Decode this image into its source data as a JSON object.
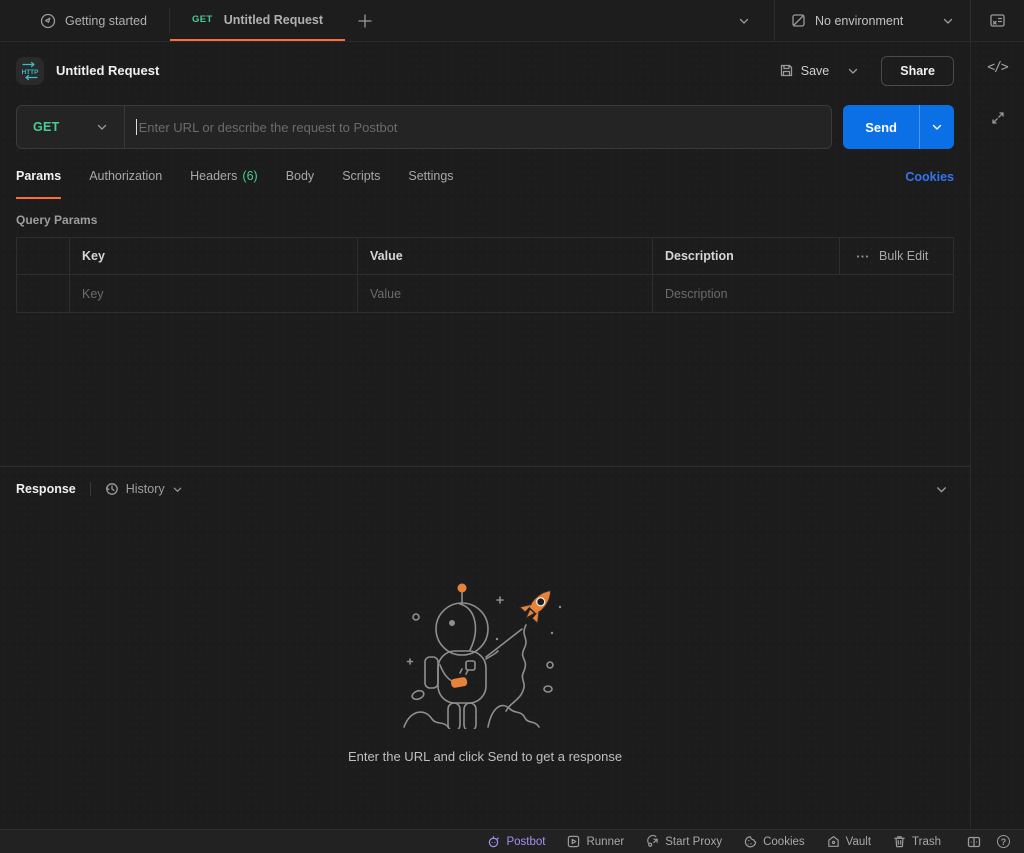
{
  "topbar": {
    "getting_started": "Getting started",
    "active_tab": {
      "method": "GET",
      "label": "Untitled Request"
    },
    "environment": "No environment"
  },
  "request": {
    "title": "Untitled Request",
    "save": "Save",
    "share": "Share",
    "method": "GET",
    "url_placeholder": "Enter URL or describe the request to Postbot",
    "send": "Send",
    "tabs": [
      {
        "label": "Params"
      },
      {
        "label": "Authorization"
      },
      {
        "label": "Headers"
      },
      {
        "label": "Body"
      },
      {
        "label": "Scripts"
      },
      {
        "label": "Settings"
      }
    ],
    "headers_count": "(6)",
    "cookies": "Cookies"
  },
  "params": {
    "title": "Query Params",
    "col_key": "Key",
    "col_value": "Value",
    "col_desc": "Description",
    "bulk_edit": "Bulk Edit",
    "ph_key": "Key",
    "ph_value": "Value",
    "ph_desc": "Description"
  },
  "response": {
    "title": "Response",
    "history": "History",
    "empty": "Enter the URL and click Send to get a response"
  },
  "footer": {
    "postbot": "Postbot",
    "runner": "Runner",
    "proxy": "Start Proxy",
    "cookies": "Cookies",
    "vault": "Vault",
    "trash": "Trash"
  },
  "colors": {
    "accent_orange": "#ff6c37",
    "method_green": "#49cc90",
    "send_blue": "#0b6fe5",
    "link_blue": "#3574f0",
    "postbot_purple": "#a58ff2"
  }
}
